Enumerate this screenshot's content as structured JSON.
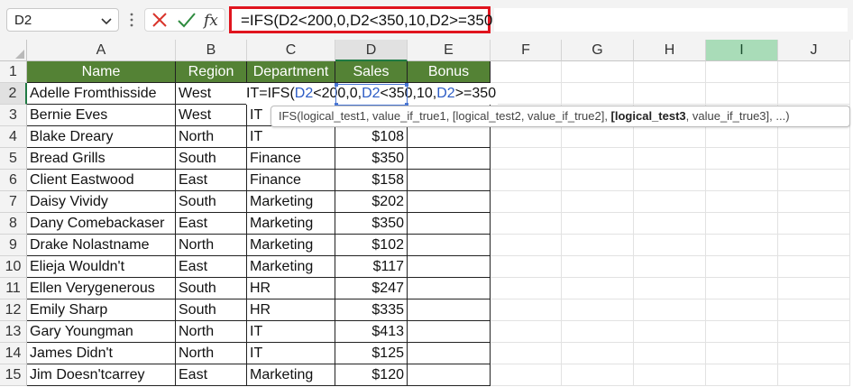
{
  "formula_bar": {
    "name_box": "D2",
    "formula": "=IFS(D2<200,0,D2<350,10,D2>=350"
  },
  "columns": [
    "A",
    "B",
    "C",
    "D",
    "E",
    "F",
    "G",
    "H",
    "I",
    "J"
  ],
  "rows": [
    "1",
    "2",
    "3",
    "4",
    "5",
    "6",
    "7",
    "8",
    "9",
    "10",
    "11",
    "12",
    "13",
    "14",
    "15"
  ],
  "table": {
    "headers": {
      "name": "Name",
      "region": "Region",
      "department": "Department",
      "sales": "Sales",
      "bonus": "Bonus"
    },
    "data": [
      {
        "name": "Adelle Fromthisside",
        "region": "West",
        "department": "",
        "sales": ""
      },
      {
        "name": "Bernie Eves",
        "region": "West",
        "department": "IT",
        "sales": ""
      },
      {
        "name": "Blake Dreary",
        "region": "North",
        "department": "IT",
        "sales": "$108"
      },
      {
        "name": "Bread Grills",
        "region": "South",
        "department": "Finance",
        "sales": "$350"
      },
      {
        "name": "Client Eastwood",
        "region": "East",
        "department": "Finance",
        "sales": "$158"
      },
      {
        "name": "Daisy Vividy",
        "region": "South",
        "department": "Marketing",
        "sales": "$202"
      },
      {
        "name": "Dany Comebackaser",
        "region": "East",
        "department": "Marketing",
        "sales": "$350"
      },
      {
        "name": "Drake Nolastname",
        "region": "North",
        "department": "Marketing",
        "sales": "$102"
      },
      {
        "name": "Elieja Wouldn't",
        "region": "East",
        "department": "Marketing",
        "sales": "$117"
      },
      {
        "name": "Ellen Verygenerous",
        "region": "South",
        "department": "HR",
        "sales": "$247"
      },
      {
        "name": "Emily Sharp",
        "region": "South",
        "department": "HR",
        "sales": "$335"
      },
      {
        "name": "Gary Youngman",
        "region": "North",
        "department": "IT",
        "sales": "$413"
      },
      {
        "name": "James Didn't",
        "region": "North",
        "department": "IT",
        "sales": "$125"
      },
      {
        "name": "Jim Doesn'tcarrey",
        "region": "East",
        "department": "Marketing",
        "sales": "$120"
      }
    ]
  },
  "cell_edit": {
    "prefix": "IT=IFS(",
    "ref1": "D2",
    "part1": "<200,0,",
    "ref2": "D2",
    "part2": "<350,10,",
    "ref3": "D2",
    "part3": ">=350"
  },
  "tooltip": {
    "before": "IFS(logical_test1, value_if_true1, [logical_test2, value_if_true2], ",
    "bold": "[logical_test3",
    "after": ", value_if_true3], ...)"
  },
  "colors": {
    "header_fill": "#548235",
    "ref_blue": "#2c5cc5",
    "highlight_red": "#e0141e",
    "selected_green": "#1f7a43"
  }
}
